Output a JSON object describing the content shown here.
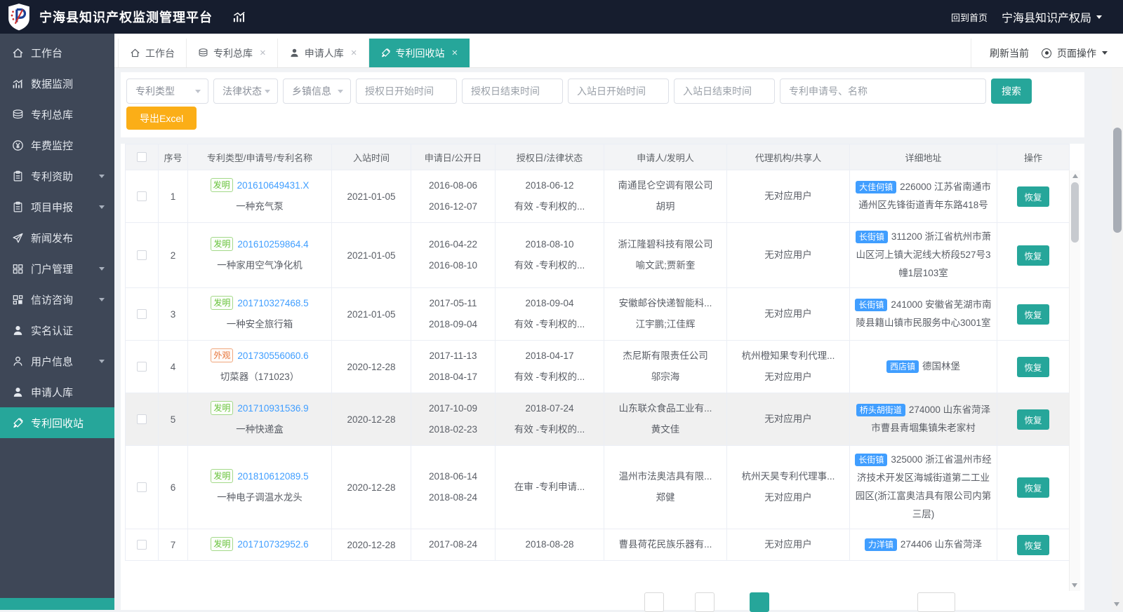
{
  "header": {
    "title": "宁海县知识产权监测管理平台",
    "home_link": "回到首页",
    "org_name": "宁海县知识产权局"
  },
  "sidebar": {
    "items": [
      {
        "id": "workbench",
        "label": "工作台",
        "icon": "home-icon",
        "expandable": false,
        "active": false
      },
      {
        "id": "data-monitor",
        "label": "数据监测",
        "icon": "chart-icon",
        "expandable": false,
        "active": false
      },
      {
        "id": "patent-library",
        "label": "专利总库",
        "icon": "layers-icon",
        "expandable": false,
        "active": false
      },
      {
        "id": "annual-fee",
        "label": "年费监控",
        "icon": "yen-icon",
        "expandable": false,
        "active": false
      },
      {
        "id": "patent-subsidy",
        "label": "专利资助",
        "icon": "clipboard-icon",
        "expandable": true,
        "active": false
      },
      {
        "id": "project-declare",
        "label": "项目申报",
        "icon": "clipboard-icon",
        "expandable": true,
        "active": false
      },
      {
        "id": "news-publish",
        "label": "新闻发布",
        "icon": "send-icon",
        "expandable": false,
        "active": false
      },
      {
        "id": "portal-manage",
        "label": "门户管理",
        "icon": "grid-icon",
        "expandable": true,
        "active": false
      },
      {
        "id": "petition-consult",
        "label": "信访咨询",
        "icon": "grid2-icon",
        "expandable": true,
        "active": false
      },
      {
        "id": "realname-auth",
        "label": "实名认证",
        "icon": "user-icon",
        "expandable": false,
        "active": false
      },
      {
        "id": "user-info",
        "label": "用户信息",
        "icon": "user-outline-icon",
        "expandable": true,
        "active": false
      },
      {
        "id": "applicant-library",
        "label": "申请人库",
        "icon": "user-icon",
        "expandable": false,
        "active": false
      },
      {
        "id": "patent-recycle",
        "label": "专利回收站",
        "icon": "brush-icon",
        "expandable": false,
        "active": true
      }
    ]
  },
  "tabs": {
    "items": [
      {
        "id": "workbench",
        "label": "工作台",
        "icon": "home-icon",
        "closable": false,
        "active": false
      },
      {
        "id": "patent-library",
        "label": "专利总库",
        "icon": "layers-icon",
        "closable": true,
        "active": false
      },
      {
        "id": "applicant-library",
        "label": "申请人库",
        "icon": "user-icon",
        "closable": true,
        "active": false
      },
      {
        "id": "patent-recycle",
        "label": "专利回收站",
        "icon": "brush-icon",
        "closable": true,
        "active": true
      }
    ],
    "refresh_label": "刷新当前",
    "page_ops_label": "页面操作"
  },
  "filters": {
    "selects": [
      "专利类型",
      "法律状态",
      "乡镇信息"
    ],
    "date_inputs": [
      "授权日开始时间",
      "授权日结束时间",
      "入站日开始时间",
      "入站日结束时间"
    ],
    "keyword_placeholder": "专利申请号、名称",
    "search_label": "搜索",
    "export_label": "导出Excel"
  },
  "table": {
    "columns": [
      "序号",
      "专利类型/申请号/专利名称",
      "入站时间",
      "申请日/公开日",
      "授权日/法律状态",
      "申请人/发明人",
      "代理机构/共享人",
      "详细地址",
      "操作"
    ],
    "action_label": "恢复",
    "rows": [
      {
        "seq": "1",
        "type": "发明",
        "type_style": "invention",
        "number": "201610649431.X",
        "name": "一种充气泵",
        "in_date": "2021-01-05",
        "apply_date": "2016-08-06",
        "publish_date": "2016-12-07",
        "grant_date": "2018-06-12",
        "status": "有效 -专利权的...",
        "applicant": "南通昆仑空调有限公司",
        "inventor": "胡玥",
        "agency": "",
        "share_user": "无对应用户",
        "town": "大佳何镇",
        "address": "226000 江苏省南通市通州区先锋街道青年东路418号",
        "highlight": false
      },
      {
        "seq": "2",
        "type": "发明",
        "type_style": "invention",
        "number": "201610259864.4",
        "name": "一种家用空气净化机",
        "in_date": "2021-01-05",
        "apply_date": "2016-04-22",
        "publish_date": "2016-08-10",
        "grant_date": "2018-08-10",
        "status": "有效 -专利权的...",
        "applicant": "浙江隆碧科技有限公司",
        "inventor": "喻文武;贾新奎",
        "agency": "",
        "share_user": "无对应用户",
        "town": "长街镇",
        "address": "311200 浙江省杭州市萧山区河上镇大泥线大桥段527号3幢1层103室",
        "highlight": false
      },
      {
        "seq": "3",
        "type": "发明",
        "type_style": "invention",
        "number": "201710327468.5",
        "name": "一种安全旅行箱",
        "in_date": "2021-01-05",
        "apply_date": "2017-05-11",
        "publish_date": "2018-09-04",
        "grant_date": "2018-09-04",
        "status": "有效 -专利权的...",
        "applicant": "安徽邮谷快递智能科...",
        "inventor": "江宇鹏;江佳辉",
        "agency": "",
        "share_user": "无对应用户",
        "town": "长街镇",
        "address": "241000 安徽省芜湖市南陵县籍山镇市民服务中心3001室",
        "highlight": false
      },
      {
        "seq": "4",
        "type": "外观",
        "type_style": "design",
        "number": "201730556060.6",
        "name": "切菜器（171023）",
        "in_date": "2020-12-28",
        "apply_date": "2017-11-13",
        "publish_date": "2018-04-17",
        "grant_date": "2018-04-17",
        "status": "有效 -专利权的...",
        "applicant": "杰尼斯有限责任公司",
        "inventor": "邬宗海",
        "agency": "杭州橙知果专利代理...",
        "share_user": "无对应用户",
        "town": "西店镇",
        "address": "德国林堡",
        "highlight": false
      },
      {
        "seq": "5",
        "type": "发明",
        "type_style": "invention",
        "number": "201710931536.9",
        "name": "一种快递盒",
        "in_date": "2020-12-28",
        "apply_date": "2017-10-09",
        "publish_date": "2018-02-23",
        "grant_date": "2018-07-24",
        "status": "有效 -专利权的...",
        "applicant": "山东联众食品工业有...",
        "inventor": "黄文佳",
        "agency": "",
        "share_user": "无对应用户",
        "town": "桥头胡街道",
        "address": "274000 山东省菏泽市曹县青堌集镇朱老家村",
        "highlight": true
      },
      {
        "seq": "6",
        "type": "发明",
        "type_style": "invention",
        "number": "201810612089.5",
        "name": "一种电子调温水龙头",
        "in_date": "2020-12-28",
        "apply_date": "2018-06-14",
        "publish_date": "2018-08-24",
        "grant_date": "",
        "status": "在审 -专利申请...",
        "applicant": "温州市法奥洁具有限...",
        "inventor": "郑健",
        "agency": "杭州天昊专利代理事...",
        "share_user": "无对应用户",
        "town": "长街镇",
        "address": "325000 浙江省温州市经济技术开发区海城街道第二工业园区(浙江富奥洁具有限公司内第三层)",
        "highlight": false
      },
      {
        "seq": "7",
        "type": "发明",
        "type_style": "invention",
        "number": "201710732952.6",
        "name": "",
        "in_date": "2020-12-28",
        "apply_date": "2017-08-24",
        "publish_date": "",
        "grant_date": "2018-08-28",
        "status": "",
        "applicant": "曹县荷花民族乐器有...",
        "inventor": "",
        "agency": "",
        "share_user": "无对应用户",
        "town": "力洋镇",
        "address": "274406 山东省菏泽",
        "highlight": false
      }
    ]
  },
  "colors": {
    "accent_teal": "#26a69a",
    "header_bg": "#161d2e",
    "sidebar_bg": "#3e4757",
    "export_orange": "#fbae17",
    "link_blue": "#409eff",
    "invention_green": "#67c23a",
    "design_orange": "#e6753a",
    "town_badge_blue": "#409eff"
  }
}
